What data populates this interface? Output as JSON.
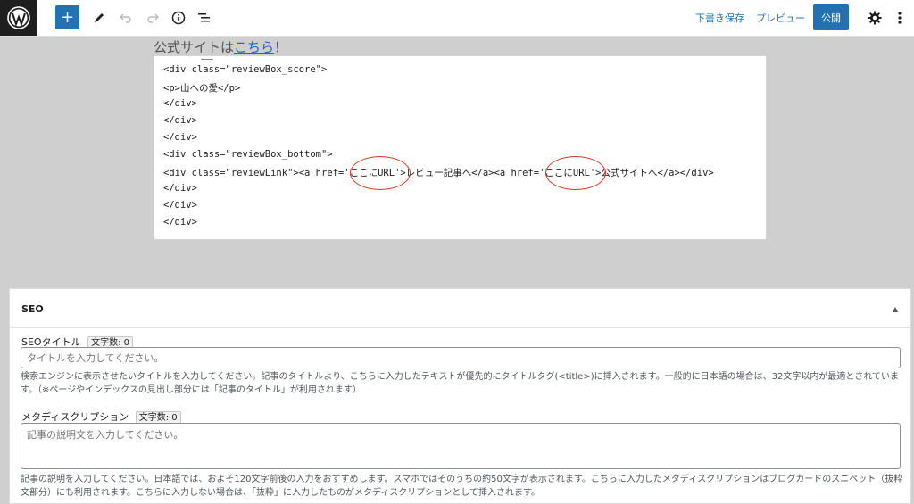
{
  "toolbar": {
    "add_label": "+",
    "save_draft": "下書き保存",
    "preview": "プレビュー",
    "publish": "公開"
  },
  "editor": {
    "partial_heading_text": "公式サイトは",
    "partial_heading_link": "こちら",
    "partial_heading_suffix": "！",
    "code_lines": [
      "<div class=\"reviewBox_score\">",
      "<p>山への愛</p>",
      "</div>",
      "</div>",
      "</div>",
      "<div class=\"reviewBox_bottom\">",
      "<div class=\"reviewLink\"><a href='ここにURL'>レビュー記事へ</a><a href='ここにURL'>公式サイトへ</a></div>",
      "</div>",
      "</div>",
      "</div>"
    ]
  },
  "seo": {
    "title": "SEO",
    "toggle": "▲",
    "seo_title_label": "SEOタイトル",
    "seo_title_counter": "文字数: 0",
    "seo_title_placeholder": "タイトルを入力してください。",
    "seo_title_help_1": "検索エンジンに表示させたいタイトルを入力してください。記事のタイトルより、こちらに入力したテキストが優先的にタイトルタグ(<title>)に挿入されます。一般的に日本語の場合は、32文字以内が最適とされていま",
    "seo_title_help_2": "す。（※ページやインデックスの見出し部分には「記事のタイトル」が利用されます）",
    "meta_label": "メタディスクリプション",
    "meta_counter": "文字数: 0",
    "meta_placeholder": "記事の説明文を入力してください。",
    "meta_help_1": "記事の説明を入力してください。日本語では、およそ120文字前後の入力をおすすめします。スマホではそのうちの約50文字が表示されます。こちらに入力したメタディスクリプションはブログカードのスニペット（抜粋",
    "meta_help_2": "文部分）にも利用されます。こちらに入力しない場合は、「抜粋」に入力したものがメタディスクリプションとして挿入されます。"
  },
  "colors": {
    "accent": "#2271b1",
    "annotation": "#d9341f",
    "canvas_bg": "#cfcfcf"
  }
}
